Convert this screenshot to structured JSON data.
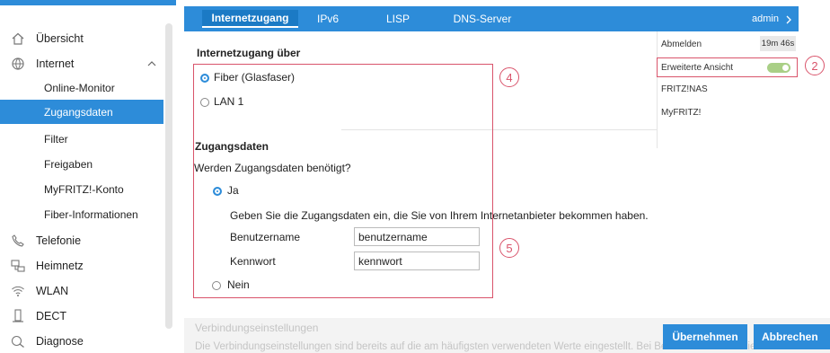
{
  "sidebar": {
    "items": [
      {
        "label": "Übersicht",
        "icon": "home-icon"
      },
      {
        "label": "Internet",
        "icon": "globe-icon"
      },
      {
        "label": "Online-Monitor"
      },
      {
        "label": "Zugangsdaten"
      },
      {
        "label": "Filter"
      },
      {
        "label": "Freigaben"
      },
      {
        "label": "MyFRITZ!-Konto"
      },
      {
        "label": "Fiber-Informationen"
      },
      {
        "label": "Telefonie",
        "icon": "phone-icon"
      },
      {
        "label": "Heimnetz",
        "icon": "network-icon"
      },
      {
        "label": "WLAN",
        "icon": "wifi-icon"
      },
      {
        "label": "DECT",
        "icon": "dect-phone-icon"
      },
      {
        "label": "Diagnose",
        "icon": "diagnose-icon"
      }
    ],
    "active_index": 3
  },
  "tabs": [
    "Internetzugang",
    "IPv6",
    "LISP",
    "DNS-Server"
  ],
  "active_tab": "Internetzugang",
  "admin": {
    "label": "admin",
    "menu": {
      "logout": "Abmelden",
      "timer": "19m 46s",
      "advanced_view": "Erweiterte Ansicht",
      "advanced_view_on": true,
      "nas": "FRITZ!NAS",
      "myfritz": "MyFRITZ!"
    }
  },
  "content": {
    "access_heading": "Internetzugang über",
    "access_options": [
      {
        "label": "Fiber (Glasfaser)",
        "selected": true
      },
      {
        "label": "LAN 1",
        "selected": false
      }
    ],
    "credentials_heading": "Zugangsdaten",
    "credentials_question": "Werden Zugangsdaten benötigt?",
    "credentials_yes": "Ja",
    "credentials_no": "Nein",
    "credentials_hint": "Geben Sie die Zugangsdaten ein, die Sie von Ihrem Internetanbieter bekommen haben.",
    "username_label": "Benutzername",
    "username_value": "benutzername",
    "password_label": "Kennwort",
    "password_value": "kennwort"
  },
  "footer": {
    "title": "Verbindungseinstellungen",
    "text": "Die Verbindungseinstellungen sind bereits auf die am häufigsten verwendeten Werte eingestellt. Bei Bedarf können Sie diese Werte",
    "apply_label": "Übernehmen",
    "cancel_label": "Abbrechen"
  },
  "annotations": [
    "2",
    "4",
    "5"
  ],
  "colors": {
    "accent": "#2d8cd9",
    "highlight": "#d9546b",
    "toggle_on": "#a9cf86"
  }
}
